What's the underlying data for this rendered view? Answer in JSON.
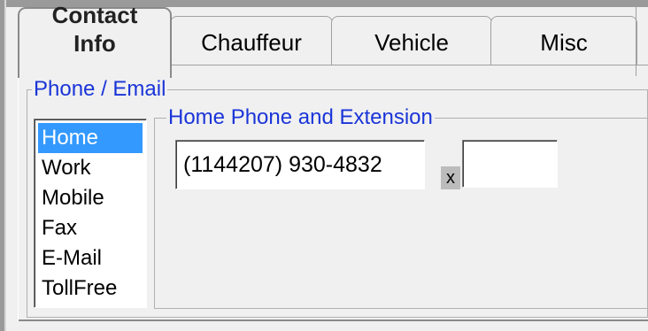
{
  "tabs": {
    "active": {
      "line1": "Contact",
      "line2": "Info"
    },
    "items": [
      {
        "label": "Chauffeur"
      },
      {
        "label": "Vehicle"
      },
      {
        "label": "Misc"
      }
    ]
  },
  "phone_email_group": {
    "title": "Phone / Email",
    "list": {
      "items": [
        "Home",
        "Work",
        "Mobile",
        "Fax",
        "E-Mail",
        "TollFree"
      ],
      "selected": "Home"
    }
  },
  "home_phone_group": {
    "title": "Home Phone and Extension",
    "phone_value": "(1144207) 930-4832",
    "extension_label": "x",
    "extension_value": ""
  },
  "colors": {
    "group_title": "#1a35d8",
    "selection": "#3399ff",
    "background": "#f0f0f0"
  }
}
